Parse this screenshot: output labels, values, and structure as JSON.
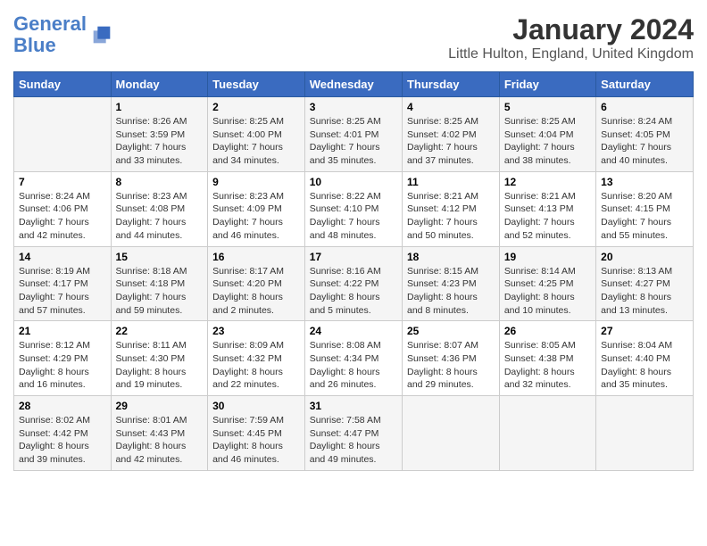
{
  "header": {
    "logo_line1": "General",
    "logo_line2": "Blue",
    "title": "January 2024",
    "subtitle": "Little Hulton, England, United Kingdom"
  },
  "days_of_week": [
    "Sunday",
    "Monday",
    "Tuesday",
    "Wednesday",
    "Thursday",
    "Friday",
    "Saturday"
  ],
  "weeks": [
    [
      {
        "day": "",
        "info": ""
      },
      {
        "day": "1",
        "info": "Sunrise: 8:26 AM\nSunset: 3:59 PM\nDaylight: 7 hours\nand 33 minutes."
      },
      {
        "day": "2",
        "info": "Sunrise: 8:25 AM\nSunset: 4:00 PM\nDaylight: 7 hours\nand 34 minutes."
      },
      {
        "day": "3",
        "info": "Sunrise: 8:25 AM\nSunset: 4:01 PM\nDaylight: 7 hours\nand 35 minutes."
      },
      {
        "day": "4",
        "info": "Sunrise: 8:25 AM\nSunset: 4:02 PM\nDaylight: 7 hours\nand 37 minutes."
      },
      {
        "day": "5",
        "info": "Sunrise: 8:25 AM\nSunset: 4:04 PM\nDaylight: 7 hours\nand 38 minutes."
      },
      {
        "day": "6",
        "info": "Sunrise: 8:24 AM\nSunset: 4:05 PM\nDaylight: 7 hours\nand 40 minutes."
      }
    ],
    [
      {
        "day": "7",
        "info": "Sunrise: 8:24 AM\nSunset: 4:06 PM\nDaylight: 7 hours\nand 42 minutes."
      },
      {
        "day": "8",
        "info": "Sunrise: 8:23 AM\nSunset: 4:08 PM\nDaylight: 7 hours\nand 44 minutes."
      },
      {
        "day": "9",
        "info": "Sunrise: 8:23 AM\nSunset: 4:09 PM\nDaylight: 7 hours\nand 46 minutes."
      },
      {
        "day": "10",
        "info": "Sunrise: 8:22 AM\nSunset: 4:10 PM\nDaylight: 7 hours\nand 48 minutes."
      },
      {
        "day": "11",
        "info": "Sunrise: 8:21 AM\nSunset: 4:12 PM\nDaylight: 7 hours\nand 50 minutes."
      },
      {
        "day": "12",
        "info": "Sunrise: 8:21 AM\nSunset: 4:13 PM\nDaylight: 7 hours\nand 52 minutes."
      },
      {
        "day": "13",
        "info": "Sunrise: 8:20 AM\nSunset: 4:15 PM\nDaylight: 7 hours\nand 55 minutes."
      }
    ],
    [
      {
        "day": "14",
        "info": "Sunrise: 8:19 AM\nSunset: 4:17 PM\nDaylight: 7 hours\nand 57 minutes."
      },
      {
        "day": "15",
        "info": "Sunrise: 8:18 AM\nSunset: 4:18 PM\nDaylight: 7 hours\nand 59 minutes."
      },
      {
        "day": "16",
        "info": "Sunrise: 8:17 AM\nSunset: 4:20 PM\nDaylight: 8 hours\nand 2 minutes."
      },
      {
        "day": "17",
        "info": "Sunrise: 8:16 AM\nSunset: 4:22 PM\nDaylight: 8 hours\nand 5 minutes."
      },
      {
        "day": "18",
        "info": "Sunrise: 8:15 AM\nSunset: 4:23 PM\nDaylight: 8 hours\nand 8 minutes."
      },
      {
        "day": "19",
        "info": "Sunrise: 8:14 AM\nSunset: 4:25 PM\nDaylight: 8 hours\nand 10 minutes."
      },
      {
        "day": "20",
        "info": "Sunrise: 8:13 AM\nSunset: 4:27 PM\nDaylight: 8 hours\nand 13 minutes."
      }
    ],
    [
      {
        "day": "21",
        "info": "Sunrise: 8:12 AM\nSunset: 4:29 PM\nDaylight: 8 hours\nand 16 minutes."
      },
      {
        "day": "22",
        "info": "Sunrise: 8:11 AM\nSunset: 4:30 PM\nDaylight: 8 hours\nand 19 minutes."
      },
      {
        "day": "23",
        "info": "Sunrise: 8:09 AM\nSunset: 4:32 PM\nDaylight: 8 hours\nand 22 minutes."
      },
      {
        "day": "24",
        "info": "Sunrise: 8:08 AM\nSunset: 4:34 PM\nDaylight: 8 hours\nand 26 minutes."
      },
      {
        "day": "25",
        "info": "Sunrise: 8:07 AM\nSunset: 4:36 PM\nDaylight: 8 hours\nand 29 minutes."
      },
      {
        "day": "26",
        "info": "Sunrise: 8:05 AM\nSunset: 4:38 PM\nDaylight: 8 hours\nand 32 minutes."
      },
      {
        "day": "27",
        "info": "Sunrise: 8:04 AM\nSunset: 4:40 PM\nDaylight: 8 hours\nand 35 minutes."
      }
    ],
    [
      {
        "day": "28",
        "info": "Sunrise: 8:02 AM\nSunset: 4:42 PM\nDaylight: 8 hours\nand 39 minutes."
      },
      {
        "day": "29",
        "info": "Sunrise: 8:01 AM\nSunset: 4:43 PM\nDaylight: 8 hours\nand 42 minutes."
      },
      {
        "day": "30",
        "info": "Sunrise: 7:59 AM\nSunset: 4:45 PM\nDaylight: 8 hours\nand 46 minutes."
      },
      {
        "day": "31",
        "info": "Sunrise: 7:58 AM\nSunset: 4:47 PM\nDaylight: 8 hours\nand 49 minutes."
      },
      {
        "day": "",
        "info": ""
      },
      {
        "day": "",
        "info": ""
      },
      {
        "day": "",
        "info": ""
      }
    ]
  ]
}
